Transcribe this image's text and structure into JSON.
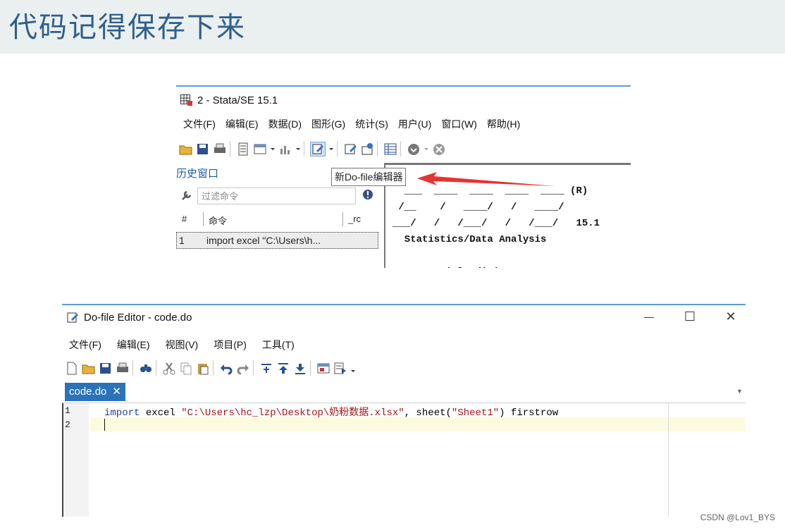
{
  "slide": {
    "title": "代码记得保存下来",
    "watermark": "CSDN @Lov1_BYS"
  },
  "stata": {
    "title": "2 - Stata/SE 15.1",
    "menu": [
      "文件(F)",
      "编辑(E)",
      "数据(D)",
      "图形(G)",
      "统计(S)",
      "用户(U)",
      "窗口(W)",
      "帮助(H)"
    ],
    "history_label": "历史窗口",
    "filter_placeholder": "过滤命令",
    "columns": {
      "num": "#",
      "command": "命令",
      "rc": "_rc"
    },
    "history_rows": [
      {
        "num": "1",
        "command": "import excel \"C:\\Users\\h..."
      }
    ],
    "results_logo": "  ___  ____  ____  ____  ____ (R)\n /__    /   ____/   /   ____/\n___/   /   /___/   /   /___/   15.1\n  Statistics/Data Analysis\n\n     Special Edition",
    "tooltip": "新Do-file编辑器",
    "colors": {
      "accent_border": "#5b9bd5",
      "history_label": "#1f5ea8",
      "annotation_arrow": "#e53333"
    }
  },
  "editor": {
    "title": "Do-file Editor - code.do",
    "window_controls": {
      "minimize": "—",
      "maximize": "☐",
      "close": "✕"
    },
    "menu": [
      "文件(F)",
      "编辑(E)",
      "视图(V)",
      "项目(P)",
      "工具(T)"
    ],
    "tab": {
      "label": "code.do",
      "close": "✕"
    },
    "line_numbers": [
      "1",
      "2"
    ],
    "code": {
      "keyword": "import",
      "command": " excel ",
      "path": "\"C:\\Users\\hc_lzp\\Desktop\\奶粉数据.xlsx\"",
      "rest_prefix": ", sheet(",
      "sheet": "\"Sheet1\"",
      "rest_suffix": ") firstrow"
    },
    "colors": {
      "tab_bg": "#2b73b9",
      "current_line": "#fdfbdf",
      "keyword": "#1f3fa0",
      "string": "#a31515"
    }
  }
}
